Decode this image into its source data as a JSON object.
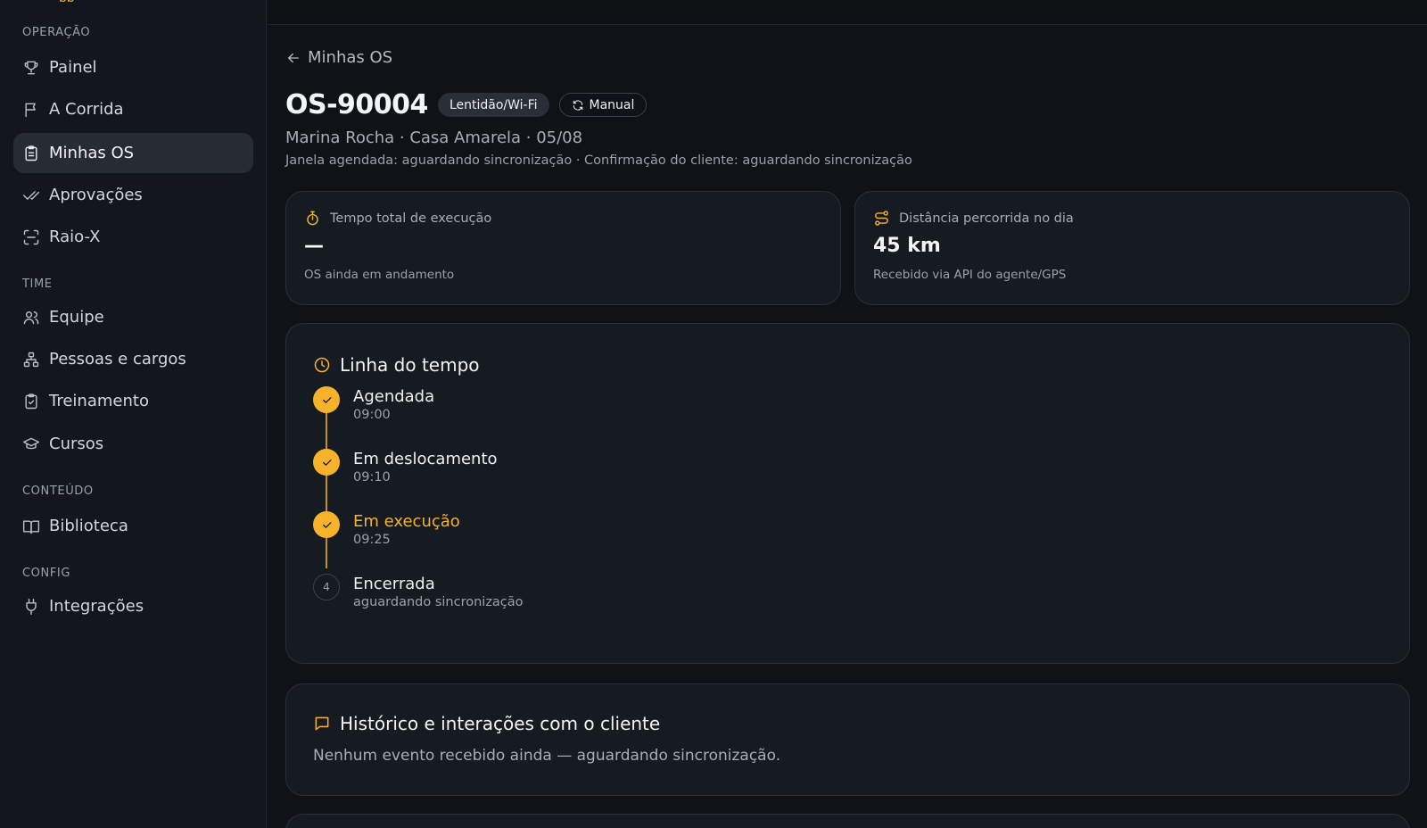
{
  "sidebar": {
    "brand_fragment": "pp",
    "sections": {
      "operacao": "OPERAÇÃO",
      "time": "TIME",
      "conteudo": "CONTEÚDO",
      "config": "CONFIG"
    },
    "items": {
      "painel": {
        "label": "Painel",
        "icon": "trophy-icon"
      },
      "corrida": {
        "label": "A Corrida",
        "icon": "flag-icon"
      },
      "minhas_os": {
        "label": "Minhas OS",
        "icon": "clipboard-icon",
        "active": true
      },
      "aprovacoes": {
        "label": "Aprovações",
        "icon": "check-double-icon"
      },
      "raio_x": {
        "label": "Raio-X",
        "icon": "scan-icon"
      },
      "equipe": {
        "label": "Equipe",
        "icon": "users-icon"
      },
      "pessoas": {
        "label": "Pessoas e cargos",
        "icon": "org-chart-icon"
      },
      "treinamento": {
        "label": "Treinamento",
        "icon": "clipboard-check-icon"
      },
      "cursos": {
        "label": "Cursos",
        "icon": "graduation-cap-icon"
      },
      "biblioteca": {
        "label": "Biblioteca",
        "icon": "book-open-icon"
      },
      "integracoes": {
        "label": "Integrações",
        "icon": "plug-icon"
      }
    }
  },
  "header": {
    "back_label": "Minhas OS",
    "os_id": "OS-90004",
    "category_badge": "Lentidão/Wi-Fi",
    "sync_badge": "Manual",
    "subtitle": "Marina Rocha · Casa Amarela · 05/08",
    "meta": "Janela agendada: aguardando sincronização · Confirmação do cliente: aguardando sincronização"
  },
  "stats": {
    "execution": {
      "label": "Tempo total de execução",
      "value": "—",
      "note": "OS ainda em andamento"
    },
    "distance": {
      "label": "Distância percorrida no dia",
      "value": "45 km",
      "note": "Recebido via API do agente/GPS"
    }
  },
  "timeline": {
    "title": "Linha do tempo",
    "steps": [
      {
        "label": "Agendada",
        "time": "09:00",
        "done": true
      },
      {
        "label": "Em deslocamento",
        "time": "09:10",
        "done": true
      },
      {
        "label": "Em execução",
        "time": "09:25",
        "done": true,
        "current": true
      },
      {
        "label": "Encerrada",
        "time": "aguardando sincronização",
        "done": false,
        "number": "4"
      }
    ]
  },
  "history": {
    "title": "Histórico e interações com o cliente",
    "empty": "Nenhum evento recebido ainda — aguardando sincronização."
  },
  "colors": {
    "accent": "#f5b22a",
    "background": "#101217",
    "card": "#161a21",
    "sidebar": "#13161c"
  }
}
